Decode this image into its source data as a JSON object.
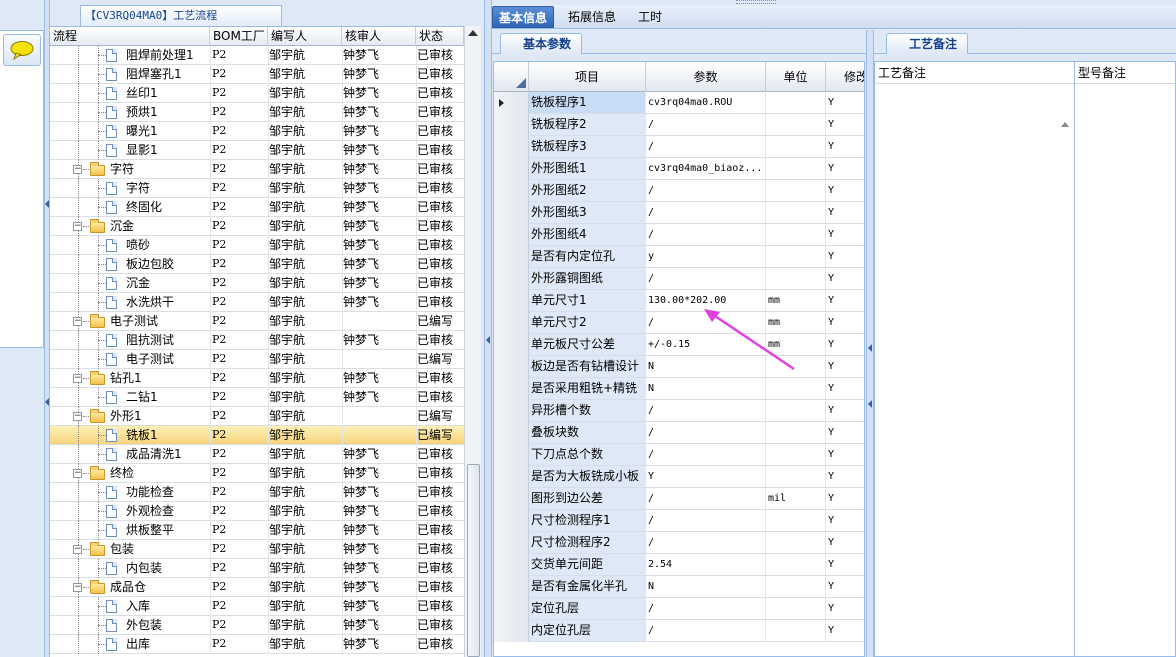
{
  "tree": {
    "title": "【CV3RQ04MA0】工艺流程",
    "columns": {
      "process": "流程",
      "bom": "BOM工厂",
      "writer": "编写人",
      "reviewer": "核审人",
      "status": "状态"
    },
    "rows": [
      {
        "level": 2,
        "label": "阻焊前处理1",
        "bom": "P2",
        "writer": "邹宇航",
        "reviewer": "钟梦飞",
        "status": "已审核"
      },
      {
        "level": 2,
        "label": "阻焊塞孔1",
        "bom": "P2",
        "writer": "邹宇航",
        "reviewer": "钟梦飞",
        "status": "已审核"
      },
      {
        "level": 2,
        "label": "丝印1",
        "bom": "P2",
        "writer": "邹宇航",
        "reviewer": "钟梦飞",
        "status": "已审核"
      },
      {
        "level": 2,
        "label": "预烘1",
        "bom": "P2",
        "writer": "邹宇航",
        "reviewer": "钟梦飞",
        "status": "已审核"
      },
      {
        "level": 2,
        "label": "曝光1",
        "bom": "P2",
        "writer": "邹宇航",
        "reviewer": "钟梦飞",
        "status": "已审核"
      },
      {
        "level": 2,
        "label": "显影1",
        "bom": "P2",
        "writer": "邹宇航",
        "reviewer": "钟梦飞",
        "status": "已审核"
      },
      {
        "level": 1,
        "label": "字符",
        "bom": "P2",
        "writer": "邹宇航",
        "reviewer": "钟梦飞",
        "status": "已审核"
      },
      {
        "level": 2,
        "label": "字符",
        "bom": "P2",
        "writer": "邹宇航",
        "reviewer": "钟梦飞",
        "status": "已审核"
      },
      {
        "level": 2,
        "label": "终固化",
        "bom": "P2",
        "writer": "邹宇航",
        "reviewer": "钟梦飞",
        "status": "已审核"
      },
      {
        "level": 1,
        "label": "沉金",
        "bom": "P2",
        "writer": "邹宇航",
        "reviewer": "钟梦飞",
        "status": "已审核"
      },
      {
        "level": 2,
        "label": "喷砂",
        "bom": "P2",
        "writer": "邹宇航",
        "reviewer": "钟梦飞",
        "status": "已审核"
      },
      {
        "level": 2,
        "label": "板边包胶",
        "bom": "P2",
        "writer": "邹宇航",
        "reviewer": "钟梦飞",
        "status": "已审核"
      },
      {
        "level": 2,
        "label": "沉金",
        "bom": "P2",
        "writer": "邹宇航",
        "reviewer": "钟梦飞",
        "status": "已审核"
      },
      {
        "level": 2,
        "label": "水洗烘干",
        "bom": "P2",
        "writer": "邹宇航",
        "reviewer": "钟梦飞",
        "status": "已审核"
      },
      {
        "level": 1,
        "label": "电子测试",
        "bom": "P2",
        "writer": "邹宇航",
        "reviewer": "",
        "status": "已编写"
      },
      {
        "level": 2,
        "label": "阻抗测试",
        "bom": "P2",
        "writer": "邹宇航",
        "reviewer": "钟梦飞",
        "status": "已审核"
      },
      {
        "level": 2,
        "label": "电子测试",
        "bom": "P2",
        "writer": "邹宇航",
        "reviewer": "",
        "status": "已编写"
      },
      {
        "level": 1,
        "label": "钻孔1",
        "bom": "P2",
        "writer": "邹宇航",
        "reviewer": "钟梦飞",
        "status": "已审核"
      },
      {
        "level": 2,
        "label": "二钻1",
        "bom": "P2",
        "writer": "邹宇航",
        "reviewer": "钟梦飞",
        "status": "已审核"
      },
      {
        "level": 1,
        "label": "外形1",
        "bom": "P2",
        "writer": "邹宇航",
        "reviewer": "",
        "status": "已编写"
      },
      {
        "level": 2,
        "label": "铣板1",
        "bom": "P2",
        "writer": "邹宇航",
        "reviewer": "",
        "status": "已编写",
        "selected": true
      },
      {
        "level": 2,
        "label": "成品清洗1",
        "bom": "P2",
        "writer": "邹宇航",
        "reviewer": "钟梦飞",
        "status": "已审核"
      },
      {
        "level": 1,
        "label": "终检",
        "bom": "P2",
        "writer": "邹宇航",
        "reviewer": "钟梦飞",
        "status": "已审核"
      },
      {
        "level": 2,
        "label": "功能检查",
        "bom": "P2",
        "writer": "邹宇航",
        "reviewer": "钟梦飞",
        "status": "已审核"
      },
      {
        "level": 2,
        "label": "外观检查",
        "bom": "P2",
        "writer": "邹宇航",
        "reviewer": "钟梦飞",
        "status": "已审核"
      },
      {
        "level": 2,
        "label": "烘板整平",
        "bom": "P2",
        "writer": "邹宇航",
        "reviewer": "钟梦飞",
        "status": "已审核"
      },
      {
        "level": 1,
        "label": "包装",
        "bom": "P2",
        "writer": "邹宇航",
        "reviewer": "钟梦飞",
        "status": "已审核"
      },
      {
        "level": 2,
        "label": "内包装",
        "bom": "P2",
        "writer": "邹宇航",
        "reviewer": "钟梦飞",
        "status": "已审核"
      },
      {
        "level": 1,
        "label": "成品仓",
        "bom": "P2",
        "writer": "邹宇航",
        "reviewer": "钟梦飞",
        "status": "已审核"
      },
      {
        "level": 2,
        "label": "入库",
        "bom": "P2",
        "writer": "邹宇航",
        "reviewer": "钟梦飞",
        "status": "已审核"
      },
      {
        "level": 2,
        "label": "外包装",
        "bom": "P2",
        "writer": "邹宇航",
        "reviewer": "钟梦飞",
        "status": "已审核"
      },
      {
        "level": 2,
        "label": "出库",
        "bom": "P2",
        "writer": "邹宇航",
        "reviewer": "钟梦飞",
        "status": "已审核"
      }
    ]
  },
  "main_tabs": [
    "基本信息",
    "拓展信息",
    "工时"
  ],
  "basic_params": {
    "tab_label": "基本参数",
    "columns": {
      "item": "项目",
      "param": "参数",
      "unit": "单位",
      "modify": "修改"
    },
    "rows": [
      {
        "item": "铣板程序1",
        "param": "cv3rq04ma0.ROU",
        "unit": "",
        "modify": "Y",
        "current": true
      },
      {
        "item": "铣板程序2",
        "param": "/",
        "unit": "",
        "modify": "Y"
      },
      {
        "item": "铣板程序3",
        "param": "/",
        "unit": "",
        "modify": "Y"
      },
      {
        "item": "外形图纸1",
        "param": "cv3rq04ma0_biaoz...",
        "unit": "",
        "modify": "Y"
      },
      {
        "item": "外形图纸2",
        "param": "/",
        "unit": "",
        "modify": "Y"
      },
      {
        "item": "外形图纸3",
        "param": "/",
        "unit": "",
        "modify": "Y"
      },
      {
        "item": "外形图纸4",
        "param": "/",
        "unit": "",
        "modify": "Y"
      },
      {
        "item": "是否有内定位孔",
        "param": "y",
        "unit": "",
        "modify": "Y"
      },
      {
        "item": "外形露铜图纸",
        "param": "/",
        "unit": "",
        "modify": "Y"
      },
      {
        "item": "单元尺寸1",
        "param": "130.00*202.00",
        "unit": "mm",
        "modify": "Y"
      },
      {
        "item": "单元尺寸2",
        "param": "/",
        "unit": "mm",
        "modify": "Y"
      },
      {
        "item": "单元板尺寸公差",
        "param": "+/-0.15",
        "unit": "mm",
        "modify": "Y"
      },
      {
        "item": "板边是否有钻槽设计",
        "param": "N",
        "unit": "",
        "modify": "Y"
      },
      {
        "item": "是否采用粗铣+精铣",
        "param": "N",
        "unit": "",
        "modify": "Y"
      },
      {
        "item": "异形槽个数",
        "param": "/",
        "unit": "",
        "modify": "Y"
      },
      {
        "item": "叠板块数",
        "param": "/",
        "unit": "",
        "modify": "Y"
      },
      {
        "item": "下刀点总个数",
        "param": "/",
        "unit": "",
        "modify": "Y"
      },
      {
        "item": "是否为大板铣成小板",
        "param": "Y",
        "unit": "",
        "modify": "Y"
      },
      {
        "item": "图形到边公差",
        "param": "/",
        "unit": "mil",
        "modify": "Y"
      },
      {
        "item": "尺寸检测程序1",
        "param": "/",
        "unit": "",
        "modify": "Y"
      },
      {
        "item": "尺寸检测程序2",
        "param": "/",
        "unit": "",
        "modify": "Y"
      },
      {
        "item": "交货单元间距",
        "param": "2.54",
        "unit": "",
        "modify": "Y"
      },
      {
        "item": "是否有金属化半孔",
        "param": "N",
        "unit": "",
        "modify": "Y"
      },
      {
        "item": "定位孔层",
        "param": "/",
        "unit": "",
        "modify": "Y"
      },
      {
        "item": "内定位孔层",
        "param": "/",
        "unit": "",
        "modify": "Y"
      }
    ]
  },
  "remarks": {
    "tab_label": "工艺备注",
    "col1": "工艺备注",
    "col2": "型号备注"
  },
  "colors": {
    "accent": "#2f66b5",
    "selection": "#f6d47b",
    "panel": "#dfe8f6",
    "annotation": "#e040e0"
  },
  "icons": {
    "chat": "speech-bubble-icon",
    "folder": "folder-icon",
    "document": "document-icon"
  }
}
